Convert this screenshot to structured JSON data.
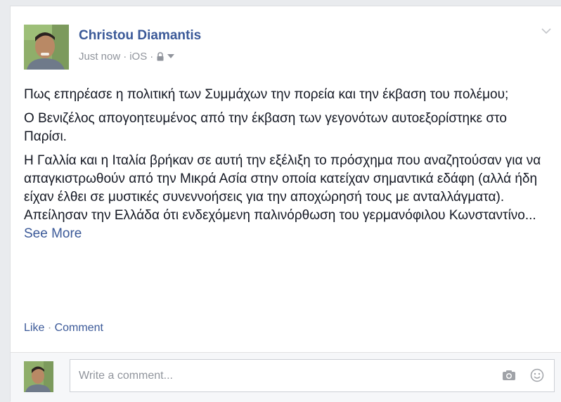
{
  "post": {
    "author": "Christou Diamantis",
    "time": "Just now",
    "via": "iOS",
    "sep1": "·",
    "sep2": "·",
    "privacy_icon": "lock-icon",
    "audience_icon": "caret-down-icon",
    "menu_icon": "chevron-down-icon",
    "paragraphs": [
      "Πως επηρέασε η πολιτική των Συμμάχων την πορεία και την έκβαση του πολέμου;",
      "Ο Βενιζέλος απογοητευμένος από την έκβαση των γεγονότων αυτοεξορίστηκε στο Παρίσι.",
      "Η Γαλλία και η Ιταλία βρήκαν σε αυτή την εξέλιξη το πρόσχημα που αναζητούσαν για να απαγκιστρωθούν από την Μικρά Ασία στην οποία κατείχαν σημαντικά εδάφη (αλλά ήδη είχαν έλθει σε μυστικές συνεννοήσεις για την αποχώρησή τους με ανταλλάγματα). Απείλησαν την Ελλάδα ότι ενδεχόμενη παλινόρθωση του γερμανόφιλου Κωνσταντίνο..."
    ],
    "see_more": "See More"
  },
  "actions": {
    "like": "Like",
    "dot": "·",
    "comment": "Comment"
  },
  "comment_box": {
    "placeholder": "Write a comment...",
    "camera_icon": "camera-icon",
    "emoji_icon": "smiley-icon"
  },
  "colors": {
    "link": "#3b5998",
    "meta": "#90949c",
    "text": "#141823"
  }
}
